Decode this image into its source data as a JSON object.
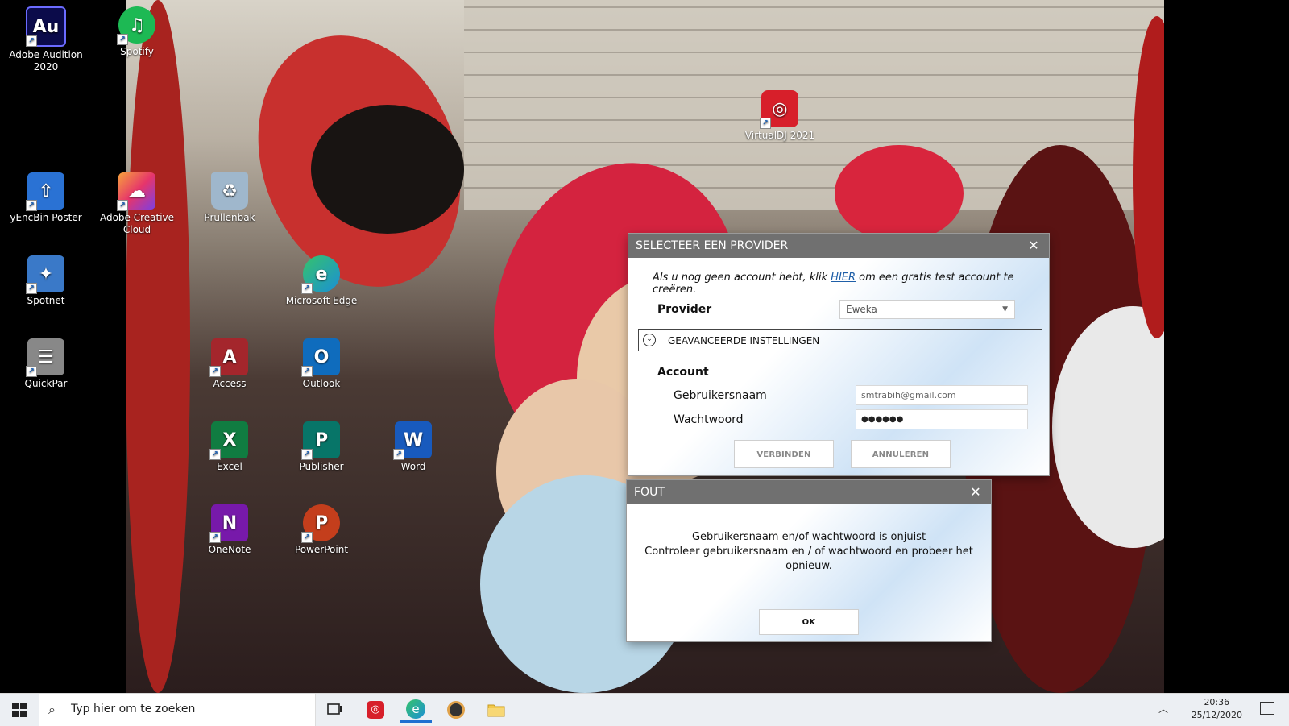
{
  "desktop": {
    "icons": [
      {
        "label": "Adobe Audition 2020",
        "glyph": "Au",
        "color": "#0b0b4a"
      },
      {
        "label": "Spotify",
        "glyph": "♫",
        "color": "#1db954"
      },
      {
        "label": "yEncBin Poster",
        "glyph": "⇧",
        "color": "#2a72d4"
      },
      {
        "label": "Adobe Creative Cloud",
        "glyph": "☁",
        "color": "#e6356b"
      },
      {
        "label": "Prullenbak",
        "glyph": "♻",
        "color": "#9fb7cc"
      },
      {
        "label": "Spotnet",
        "glyph": "✦",
        "color": "#3a79c8"
      },
      {
        "label": "Microsoft Edge",
        "glyph": "e",
        "color": "#1b8fd6"
      },
      {
        "label": "QuickPar",
        "glyph": "☰",
        "color": "#888"
      },
      {
        "label": "Access",
        "glyph": "A",
        "color": "#a4262c"
      },
      {
        "label": "Outlook",
        "glyph": "O",
        "color": "#0f6cbd"
      },
      {
        "label": "Excel",
        "glyph": "X",
        "color": "#107c41"
      },
      {
        "label": "Publisher",
        "glyph": "P",
        "color": "#077568"
      },
      {
        "label": "Word",
        "glyph": "W",
        "color": "#185abd"
      },
      {
        "label": "OneNote",
        "glyph": "N",
        "color": "#7719aa"
      },
      {
        "label": "PowerPoint",
        "glyph": "P",
        "color": "#c43e1c"
      },
      {
        "label": "VirtualDJ 2021",
        "glyph": "◎",
        "color": "#d71f2a"
      }
    ]
  },
  "provider_dialog": {
    "title": "SELECTEER EEN PROVIDER",
    "close": "✕",
    "intro_before": "Als u nog geen account hebt, klik ",
    "intro_link": "HIER",
    "intro_after": " om een gratis test account te creëren.",
    "provider_label": "Provider",
    "provider_value": "Eweka",
    "advanced_label": "GEAVANCEERDE INSTELLINGEN",
    "account_label": "Account",
    "username_label": "Gebruikersnaam",
    "username_value": "smtrabih@gmail.com",
    "password_label": "Wachtwoord",
    "password_value": "●●●●●●",
    "connect_button": "VERBINDEN",
    "cancel_button": "ANNULEREN"
  },
  "error_dialog": {
    "title": "FOUT",
    "close": "✕",
    "line1": "Gebruikersnaam en/of wachtwoord is onjuist",
    "line2": "Controleer gebruikersnaam en / of wachtwoord en probeer het opnieuw.",
    "ok_button": "OK"
  },
  "taskbar": {
    "search_placeholder": "Typ hier om te zoeken",
    "time": "20:36",
    "date": "25/12/2020"
  }
}
